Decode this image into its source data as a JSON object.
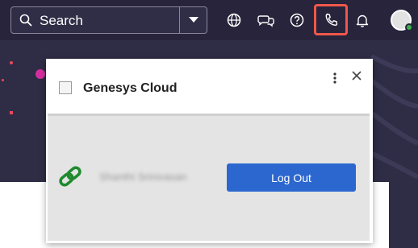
{
  "topbar": {
    "search_label": "Search",
    "icons": [
      "search-icon",
      "chevron-down-icon",
      "globe-icon",
      "chat-icon",
      "help-icon",
      "phone-icon",
      "bell-icon",
      "avatar"
    ]
  },
  "popup": {
    "title": "Genesys Cloud",
    "user_name": "Shanthi Srinivasan",
    "logout_label": "Log Out"
  },
  "colors": {
    "topbar": "#27243c",
    "background": "#2f2c45",
    "highlight": "#f0574a",
    "logout_button": "#2c67cf",
    "link_icon": "#1f8a2e",
    "presence": "#3bb34a"
  }
}
